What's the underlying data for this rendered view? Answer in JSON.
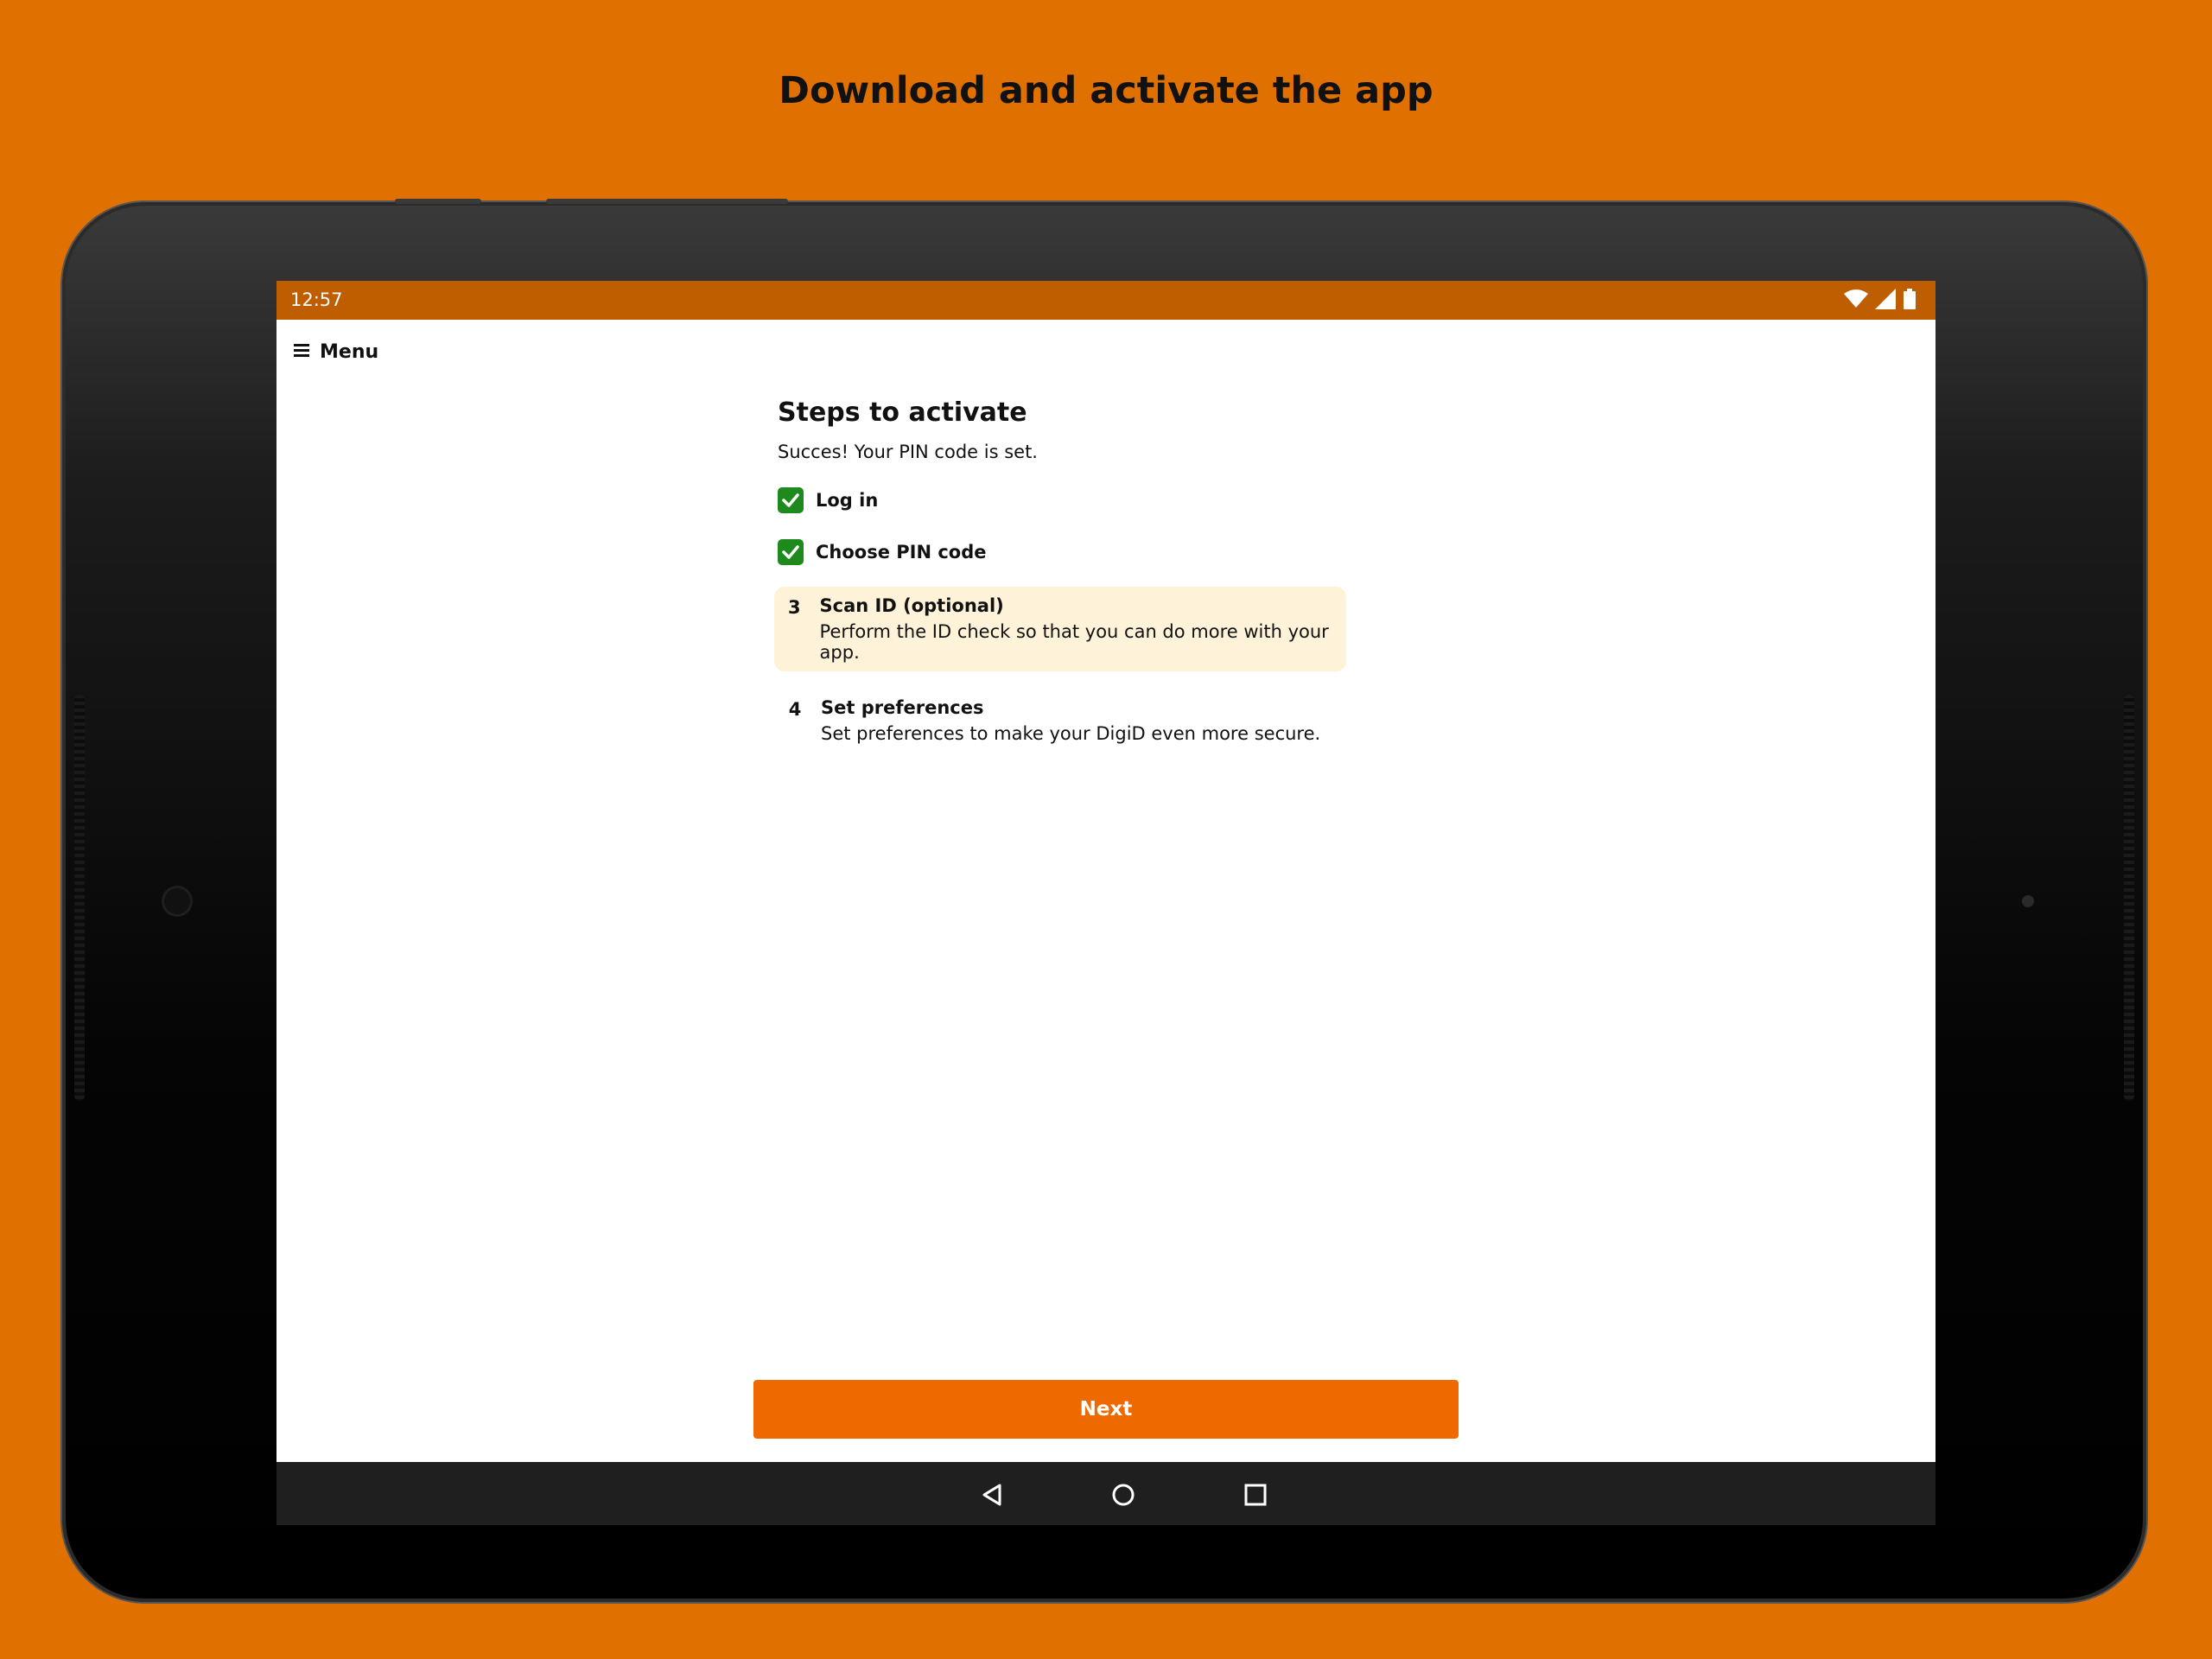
{
  "headline": "Download and activate the app",
  "status_bar": {
    "time": "12:57",
    "icons": [
      "wifi-icon",
      "signal-icon",
      "battery-icon"
    ]
  },
  "app_bar": {
    "menu_label": "Menu",
    "menu_icon": "hamburger-icon"
  },
  "page": {
    "title": "Steps to activate",
    "subtitle": "Succes! Your PIN code is set."
  },
  "steps": [
    {
      "status": "done",
      "label": "Log in"
    },
    {
      "status": "done",
      "label": "Choose PIN code"
    },
    {
      "status": "active",
      "number": "3",
      "title": "Scan ID (optional)",
      "description": "Perform the ID check so that you can do more with your app."
    },
    {
      "status": "todo",
      "number": "4",
      "title": "Set preferences",
      "description": "Set preferences to make your DigiD even more secure."
    }
  ],
  "next_button": {
    "label": "Next"
  },
  "nav_bar": {
    "buttons": [
      "back-icon",
      "home-icon",
      "recents-icon"
    ]
  },
  "colors": {
    "background": "#E07000",
    "status_bar": "#BE5E00",
    "primary_button": "#EE6A00",
    "check": "#1E8A1E",
    "active_step_bg": "#FEF2D9"
  }
}
